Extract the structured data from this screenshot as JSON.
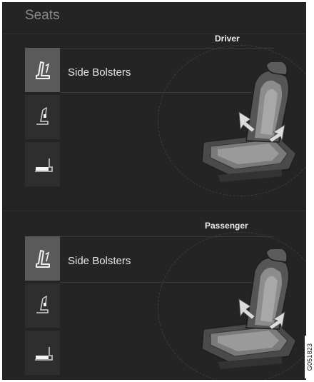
{
  "header": {
    "title": "Seats"
  },
  "driver": {
    "title": "Driver",
    "options": [
      {
        "icon": "seat-side-bolster-icon",
        "label": "Side Bolsters",
        "selected": true
      },
      {
        "icon": "seat-lumbar-icon",
        "label": "",
        "selected": false
      },
      {
        "icon": "seat-cushion-icon",
        "label": "",
        "selected": false
      }
    ]
  },
  "passenger": {
    "title": "Passenger",
    "options": [
      {
        "icon": "seat-side-bolster-icon",
        "label": "Side Bolsters",
        "selected": true
      },
      {
        "icon": "seat-lumbar-icon",
        "label": "",
        "selected": false
      },
      {
        "icon": "seat-cushion-icon",
        "label": "",
        "selected": false
      }
    ]
  },
  "figure_code": "G051823",
  "colors": {
    "background": "#242424",
    "selected": "#5a5a5a",
    "button": "#2e2e2e",
    "arrow": "#d8d8d8"
  }
}
